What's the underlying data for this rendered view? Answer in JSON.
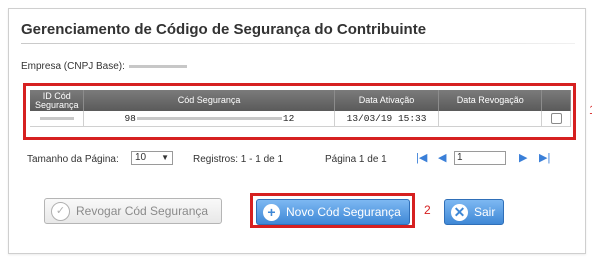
{
  "page": {
    "title": "Gerenciamento de Código de Segurança do Contribuinte",
    "empresa_label": "Empresa (CNPJ Base):"
  },
  "grid": {
    "columns": [
      "ID Cód Segurança",
      "Cód Segurança",
      "Data Ativação",
      "Data Revogação",
      ""
    ],
    "rows": [
      {
        "cod_prefix": "98",
        "cod_suffix": "12",
        "data_ativacao": "13/03/19 15:33",
        "data_revogacao": ""
      }
    ],
    "marker": "1"
  },
  "pager": {
    "page_size_label": "Tamanho da Página:",
    "page_size_value": "10",
    "records_text": "Registros: 1 - 1 de 1",
    "page_text": "Página 1 de 1",
    "page_input_value": "1"
  },
  "buttons": {
    "revogar_label": "Revogar Cód Segurança",
    "novo_label": "Novo Cód Segurança",
    "novo_marker": "2",
    "sair_label": "Sair"
  },
  "colors": {
    "highlight_red": "#d62020",
    "primary_blue": "#3f88d6",
    "header_gray": "#6a6a6a"
  }
}
